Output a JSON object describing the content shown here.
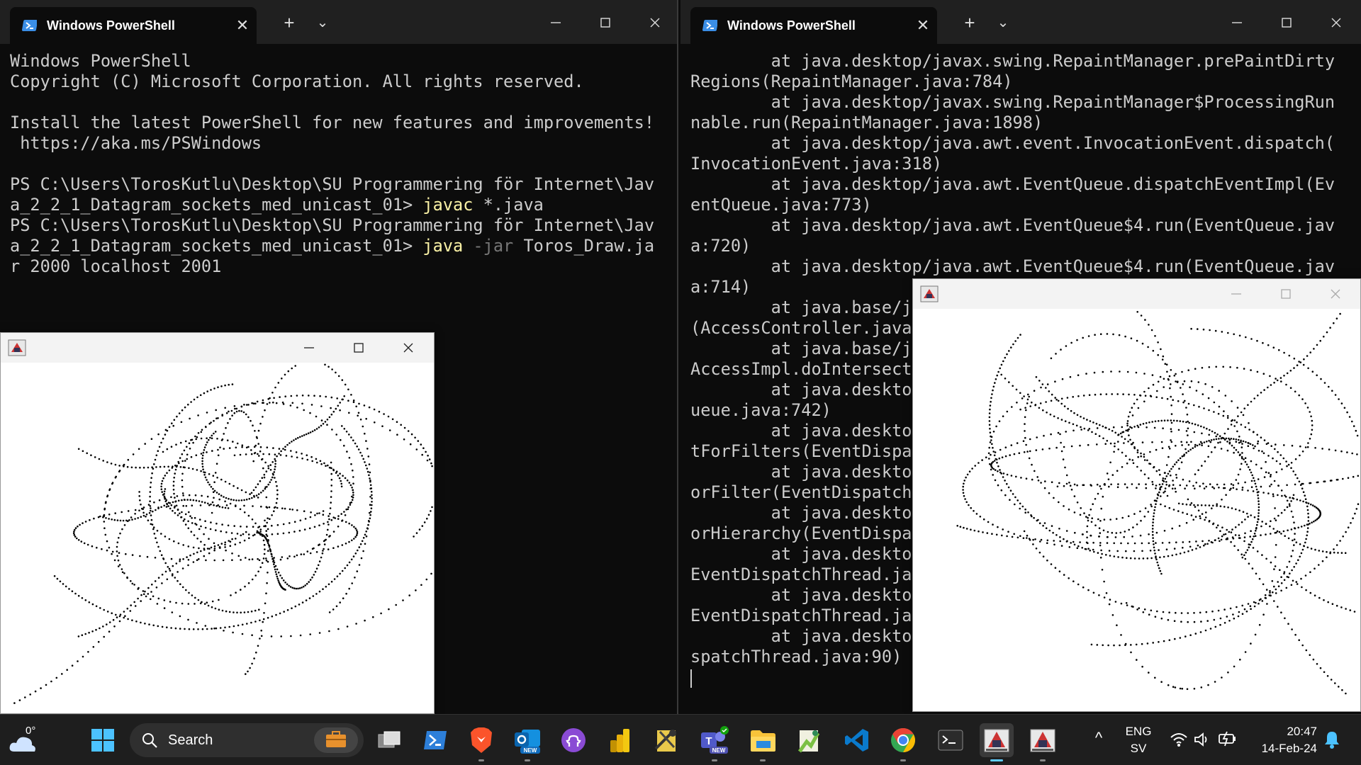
{
  "left_terminal": {
    "tab_title": "Windows PowerShell",
    "new_tab": "+",
    "dropdown": "⌄",
    "lines": [
      [
        {
          "t": "Windows PowerShell",
          "c": "text"
        }
      ],
      [
        {
          "t": "Copyright (C) Microsoft Corporation. All rights reserved.",
          "c": "text"
        }
      ],
      [],
      [
        {
          "t": "Install the latest PowerShell for new features and improvements!",
          "c": "text"
        }
      ],
      [
        {
          "t": " https://aka.ms/PSWindows",
          "c": "text"
        }
      ],
      [],
      [
        {
          "t": "PS C:\\Users\\TorosKutlu\\Desktop\\SU Programmering för Internet\\Jav",
          "c": "text"
        }
      ],
      [
        {
          "t": "a_2_2_1_Datagram_sockets_med_unicast_01> ",
          "c": "text"
        },
        {
          "t": "javac",
          "c": "cmd"
        },
        {
          "t": " *.java",
          "c": "text"
        }
      ],
      [
        {
          "t": "PS C:\\Users\\TorosKutlu\\Desktop\\SU Programmering för Internet\\Jav",
          "c": "text"
        }
      ],
      [
        {
          "t": "a_2_2_1_Datagram_sockets_med_unicast_01> ",
          "c": "text"
        },
        {
          "t": "java",
          "c": "cmd"
        },
        {
          "t": " -jar",
          "c": "param"
        },
        {
          "t": " Toros_Draw.ja",
          "c": "text"
        }
      ],
      [
        {
          "t": "r 2000 localhost 2001",
          "c": "text"
        }
      ]
    ]
  },
  "right_terminal": {
    "tab_title": "Windows PowerShell",
    "new_tab": "+",
    "dropdown": "⌄",
    "lines": [
      "        at java.desktop/javax.swing.RepaintManager.prePaintDirty",
      "Regions(RepaintManager.java:784)",
      "        at java.desktop/javax.swing.RepaintManager$ProcessingRun",
      "nable.run(RepaintManager.java:1898)",
      "        at java.desktop/java.awt.event.InvocationEvent.dispatch(",
      "InvocationEvent.java:318)",
      "        at java.desktop/java.awt.EventQueue.dispatchEventImpl(Ev",
      "entQueue.java:773)",
      "        at java.desktop/java.awt.EventQueue$4.run(EventQueue.jav",
      "a:720)",
      "        at java.desktop/java.awt.EventQueue$4.run(EventQueue.jav",
      "a:714)",
      "        at java.base/ja",
      "(AccessController.java",
      "        at java.base/ja",
      "AccessImpl.doIntersecti",
      "        at java.desktop",
      "ueue.java:742)",
      "        at java.desktop",
      "tForFilters(EventDispat",
      "        at java.desktop",
      "orFilter(EventDispatchT",
      "        at java.desktop",
      "orHierarchy(EventDispat",
      "        at java.desktop",
      "EventDispatchThread.jav",
      "        at java.desktop",
      "EventDispatchThread.jav",
      "        at java.desktop",
      "spatchThread.java:90)"
    ]
  },
  "taskbar": {
    "weather_temp": "0°",
    "search_label": "Search",
    "lang_top": "ENG",
    "lang_bottom": "SV",
    "time": "20:47",
    "date": "14-Feb-24",
    "chevron": "^",
    "teams_badge": "NEW",
    "outlook_badge": "NEW"
  },
  "colors": {
    "terminal_bg": "#0c0c0c",
    "terminal_text": "#cccccc",
    "command": "#f9f1a5",
    "parameter": "#767676",
    "taskbar_bg": "#1e1e1e",
    "accent": "#60cdff"
  }
}
